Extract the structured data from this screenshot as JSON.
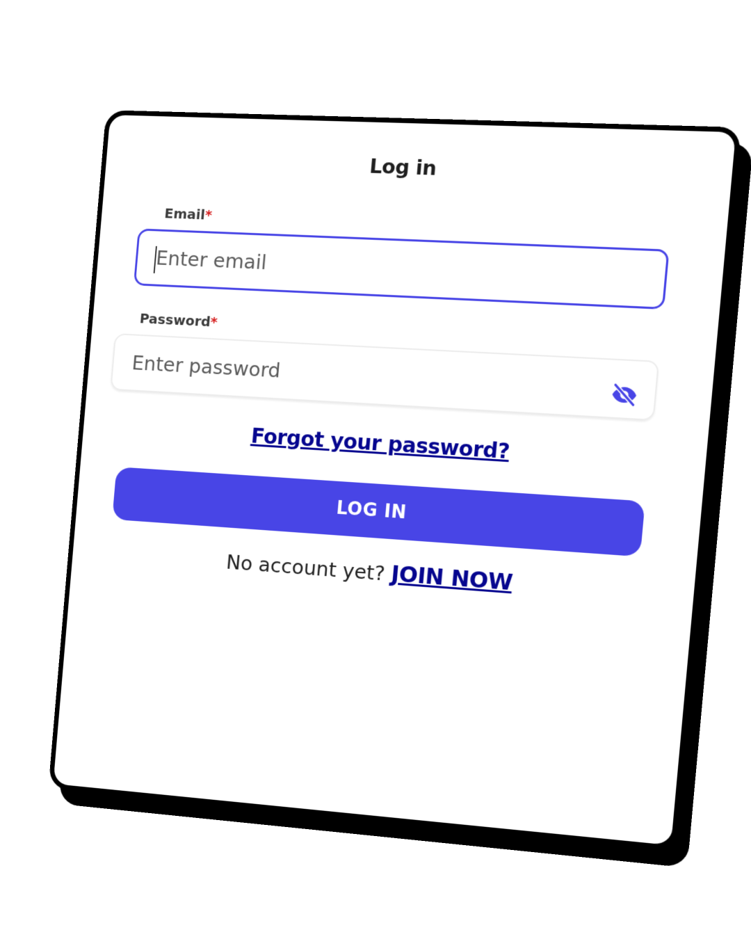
{
  "login_form": {
    "title": "Log in",
    "email": {
      "label": "Email",
      "required_mark": "*",
      "placeholder": "Enter email",
      "value": ""
    },
    "password": {
      "label": "Password",
      "required_mark": "*",
      "placeholder": "Enter password",
      "value": "",
      "toggle_icon": "eye-slash-icon"
    },
    "forgot_password_link": "Forgot your password?",
    "submit_label": "LOG IN",
    "signup_prompt": "No account yet?",
    "signup_link": "JOIN NOW"
  },
  "colors": {
    "accent": "#4845e6",
    "link": "#06068f",
    "required": "#d62020",
    "card_border": "#000000"
  }
}
